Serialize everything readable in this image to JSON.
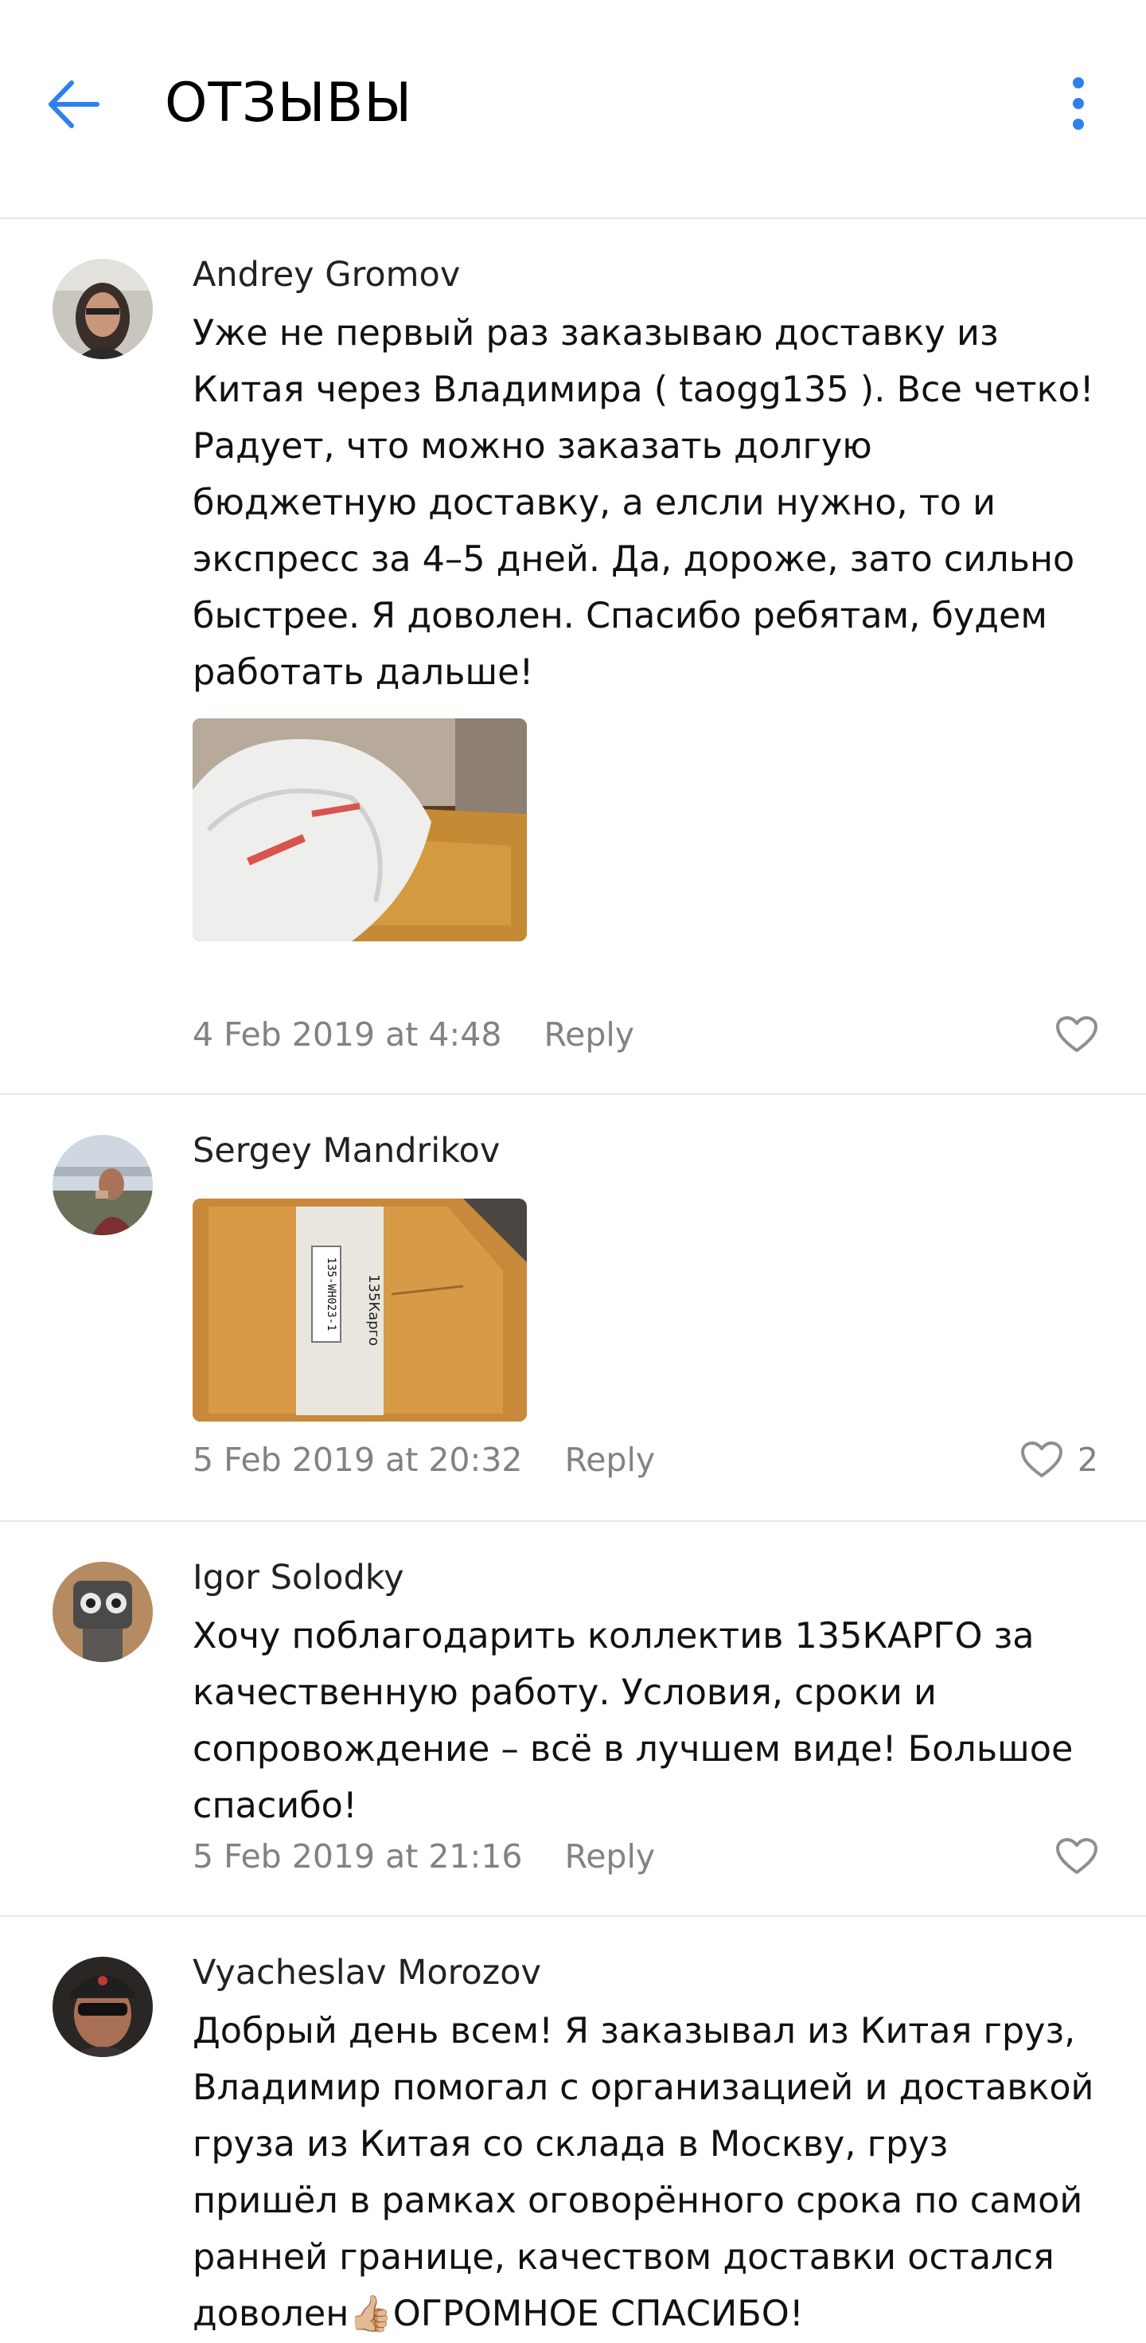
{
  "header": {
    "title": "ОТЗЫВЫ"
  },
  "reviews": [
    {
      "author": "Andrey Gromov",
      "text": "Уже не первый раз заказываю доставку из Китая через Владимира ( taogg135 ). Все четко! Радует, что можно заказать долгую бюджетную доставку, а елсли нужно, то и экспресс за 4–5 дней. Да, дороже, зато сильно быстрее. Я доволен. Спасибо ребятам, будем работать дальше!",
      "date": "4 Feb 2019 at 4:48",
      "reply": "Reply",
      "likes": ""
    },
    {
      "author": "Sergey Mandrikov",
      "text": "",
      "date": "5 Feb 2019 at 20:32",
      "reply": "Reply",
      "likes": "2",
      "photo_labels": [
        "135Карго",
        "135-WH023-1"
      ]
    },
    {
      "author": "Igor Solodky",
      "text": "Хочу поблагодарить коллектив 135КАРГО за качественную работу. Условия, сроки и сопровождение – всё в лучшем виде! Большое спасибо!",
      "date": "5 Feb 2019 at 21:16",
      "reply": "Reply",
      "likes": ""
    },
    {
      "author": "Vyacheslav Morozov",
      "text": "Добрый день всем! Я заказывал из Китая груз, Владимир помогал с организацией и доставкой груза из Китая со склада в Москву, груз пришёл в рамках оговорённого срока по самой ранней границе, качеством доставки остался доволен👍🏼ОГРОМНОЕ СПАСИБО!"
    }
  ],
  "colors": {
    "accent": "#2f80ed",
    "meta": "#828282",
    "divider": "#e7e8ec"
  }
}
